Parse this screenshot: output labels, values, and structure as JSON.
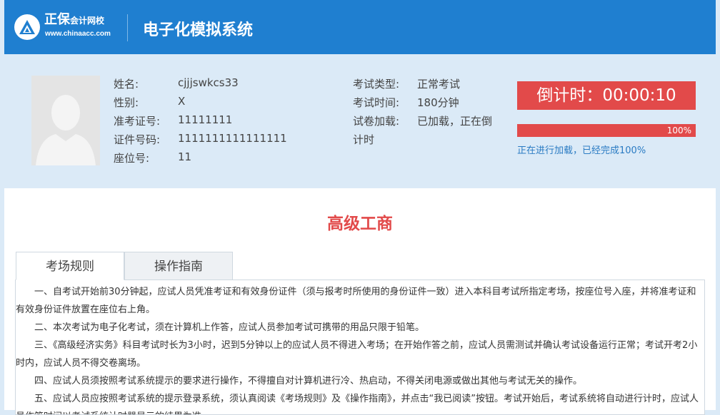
{
  "header": {
    "brand_name": "正保",
    "brand_sub": "会计网校",
    "site_url": "www.chinaacc.com",
    "system_title": "电子化模拟系统"
  },
  "candidate": {
    "name_label": "姓名:",
    "name_value": "cjjjswkcs33",
    "gender_label": "性别:",
    "gender_value": "X",
    "ticket_label": "准考证号:",
    "ticket_value": "11111111",
    "id_label": "证件号码:",
    "id_value": "1111111111111111",
    "seat_label": "座位号:",
    "seat_value": "11"
  },
  "exam": {
    "type_label": "考试类型:",
    "type_value": "正常考试",
    "duration_label": "考试时间:",
    "duration_value": "180分钟",
    "load_label": "试卷加载:",
    "load_value_line1": "已加载，正在倒",
    "load_value_line2": "计时"
  },
  "countdown": {
    "text": "倒计时：00:00:10",
    "progress_percent": 100,
    "progress_text": "100%",
    "status_text": "正在进行加载，已经完成100%"
  },
  "subject_title": "高级工商",
  "tabs": [
    {
      "label": "考场规则",
      "active": true
    },
    {
      "label": "操作指南",
      "active": false
    }
  ],
  "rules": [
    "一、自考试开始前30分钟起，应试人员凭准考证和有效身份证件（须与报考时所使用的身份证件一致）进入本科目考试所指定考场，按座位号入座，并将准考证和有效身份证件放置在座位右上角。",
    "二、本次考试为电子化考试，须在计算机上作答，应试人员参加考试可携带的用品只限于铅笔。",
    "三、《高级经济实务》科目考试时长为3小时，迟到5分钟以上的应试人员不得进入考场；在开始作答之前，应试人员需测试并确认考试设备运行正常；考试开考2小时内，应试人员不得交卷离场。",
    "四、应试人员须按照考试系统提示的要求进行操作，不得擅自对计算机进行冷、热启动，不得关闭电源或做出其他与考试无关的操作。",
    "五、应试人员应按照考试系统的提示登录系统，须认真阅读《考场规则》及《操作指南》，并点击“我已阅读”按钮。考试开始后，考试系统将自动进行计时，应试人员作答时间以考试系统计时器显示的结果为准。"
  ],
  "colors": {
    "header_bg": "#1f7fd0",
    "info_bg": "#dbeaf7",
    "accent_red": "#e24a4a",
    "status_blue": "#2a7bc3"
  }
}
